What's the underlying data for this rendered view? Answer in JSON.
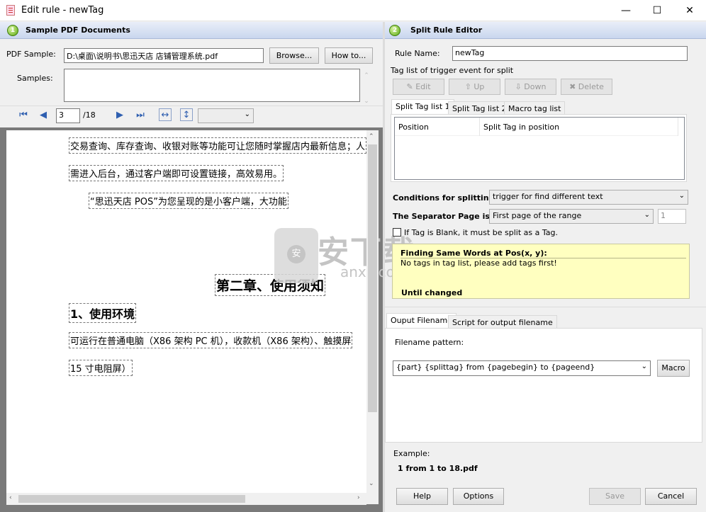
{
  "window": {
    "title": "Edit rule - newTag",
    "minimize": "—",
    "maximize": "☐",
    "close": "✕"
  },
  "left_panel": {
    "header": "Sample PDF Documents",
    "step": "1",
    "pdf_sample_label": "PDF Sample:",
    "pdf_sample_value": "D:\\桌面\\说明书\\思迅天店 店铺管理系统.pdf",
    "browse_button": "Browse...",
    "howto_button": "How to...",
    "samples_label": "Samples:",
    "page_current": "3",
    "page_total": "/18",
    "zoom_value": "",
    "doc_lines": [
      "交易查询、库存查询、收银对账等功能可让您随时掌握店内最新信息；人",
      "需进入后台，通过客户端即可设置链接，高效易用。",
      "“思迅天店 POS”为您呈现的是小客户端，大功能",
      "第二章、使用须知",
      "1、使用环境",
      "可运行在普通电脑（X86 架构 PC 机），收款机（X86 架构）、触摸屏",
      "15 寸电阻屏）"
    ]
  },
  "right_panel": {
    "header": "Split Rule Editor",
    "step": "2",
    "rule_name_label": "Rule Name:",
    "rule_name_value": "newTag",
    "tag_list_label": "Tag list of trigger event for split",
    "edit_button": "Edit",
    "up_button": "Up",
    "down_button": "Down",
    "delete_button": "Delete",
    "tag_tabs": [
      "Split Tag list 1",
      "Split Tag list 2",
      "Macro tag list"
    ],
    "columns": [
      "Position",
      "Split Tag in position"
    ],
    "conditions_label": "Conditions for splitting:",
    "conditions_value": "trigger for find different text",
    "separator_label": "The Separator Page is:",
    "separator_value": "First page of the range",
    "separator_num": "1",
    "blank_tag_label": "If Tag is Blank, it must be split as a Tag.",
    "hint_title": "Finding Same Words at Pos(x, y):",
    "hint_text": "No tags in tag list, please add tags first!",
    "hint_footer": "Until changed",
    "output_tabs": [
      "Ouput Filename",
      "Script for output filename"
    ],
    "filename_pattern_label": "Filename pattern:",
    "filename_pattern_value": "{part} {splittag} from {pagebegin} to {pageend}",
    "macro_button": "Macro",
    "example_label": "Example:",
    "example_value": "1  from 1 to 18.pdf",
    "help_button": "Help",
    "options_button": "Options",
    "save_button": "Save",
    "cancel_button": "Cancel"
  },
  "watermark": {
    "text": "安下载",
    "domain": "anxz.com"
  }
}
